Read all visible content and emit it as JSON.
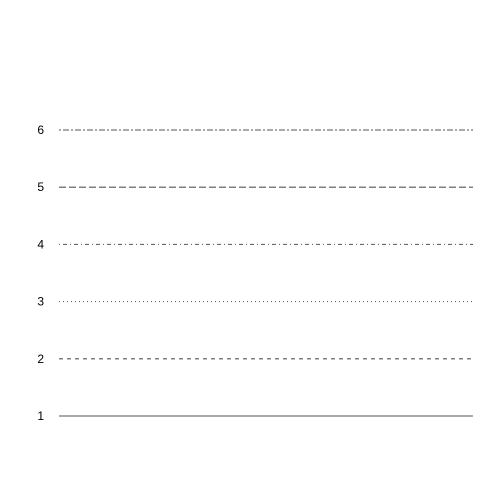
{
  "chart_data": {
    "type": "line",
    "title": "",
    "xlabel": "",
    "ylabel": "",
    "ylim": [
      1,
      6
    ],
    "grid": false,
    "legend": "none",
    "line_color": "#555555",
    "series": [
      {
        "y": 1,
        "label": "1",
        "linetype": "solid"
      },
      {
        "y": 2,
        "label": "2",
        "linetype": "dashed"
      },
      {
        "y": 3,
        "label": "3",
        "linetype": "dotted"
      },
      {
        "y": 4,
        "label": "4",
        "linetype": "dotdash"
      },
      {
        "y": 5,
        "label": "5",
        "linetype": "longdash"
      },
      {
        "y": 6,
        "label": "6",
        "linetype": "twodash"
      }
    ]
  }
}
